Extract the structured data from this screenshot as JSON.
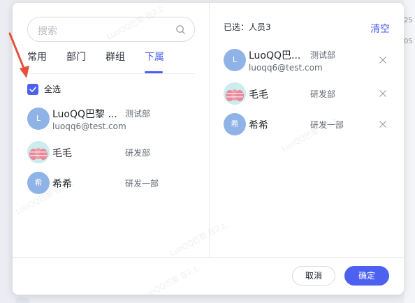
{
  "background": {
    "fragment_1": "25",
    "fragment_2": "05"
  },
  "search": {
    "placeholder": "搜索"
  },
  "tabs": [
    {
      "label": "常用",
      "active": false
    },
    {
      "label": "部门",
      "active": false
    },
    {
      "label": "群组",
      "active": false
    },
    {
      "label": "下属",
      "active": true
    }
  ],
  "select_all": {
    "label": "全选",
    "checked": true
  },
  "members": [
    {
      "name": "LuoQQ巴黎 ...",
      "email": "luoqq6@test.com",
      "dept": "测试部",
      "avatar_text": "L"
    },
    {
      "name": "毛毛",
      "dept": "研发部",
      "avatar_text": ""
    },
    {
      "name": "希希",
      "dept": "研发一部",
      "avatar_text": "希"
    }
  ],
  "selected": {
    "header": "已选：人员3",
    "clear_label": "清空",
    "items": [
      {
        "name": "LuoQQ巴...",
        "email": "luoqq6@test.com",
        "dept": "测试部",
        "avatar_text": "L"
      },
      {
        "name": "毛毛",
        "dept": "研发部",
        "avatar_text": ""
      },
      {
        "name": "希希",
        "dept": "研发一部",
        "avatar_text": "希"
      }
    ]
  },
  "footer": {
    "cancel_label": "取消",
    "ok_label": "确定"
  },
  "watermark_text": "LuoQQ巴黎 在2上",
  "colors": {
    "accent": "#4d61f0",
    "avatar": "#8fb3e6",
    "annotation_arrow": "#e4503b"
  }
}
